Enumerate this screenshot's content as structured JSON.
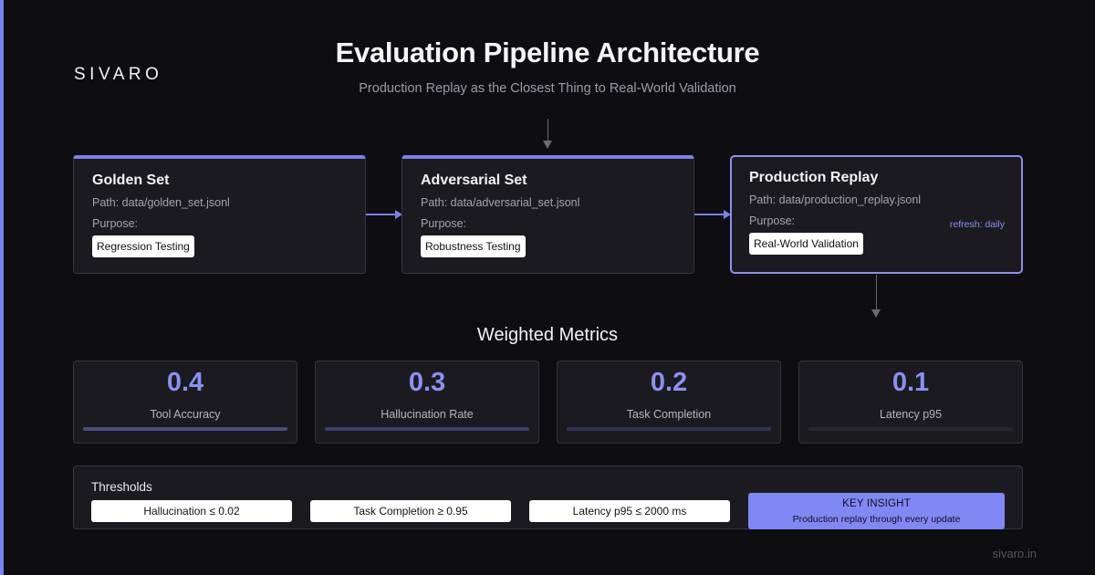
{
  "brand": {
    "logo": "SIVARO",
    "footer_url": "sivaro.in",
    "accent_color": "#7b80f0"
  },
  "header": {
    "title": "Evaluation Pipeline Architecture",
    "subtitle": "Production Replay as the Closest Thing to Real-World Validation"
  },
  "pipeline": {
    "stages": [
      {
        "name": "Golden Set",
        "path": "Path: data/golden_set.jsonl",
        "purpose_label": "Purpose:",
        "purpose": "Regression Testing",
        "note": "",
        "active": false
      },
      {
        "name": "Adversarial Set",
        "path": "Path: data/adversarial_set.jsonl",
        "purpose_label": "Purpose:",
        "purpose": "Robustness Testing",
        "note": "",
        "active": false
      },
      {
        "name": "Production Replay",
        "path": "Path: data/production_replay.jsonl",
        "purpose_label": "Purpose:",
        "purpose": "Real-World Validation",
        "note": "refresh: daily",
        "active": true
      }
    ]
  },
  "metrics": {
    "title": "Weighted Metrics",
    "items": [
      {
        "value": "0.4",
        "label": "Tool Accuracy",
        "weight": 0.4,
        "bar_color": "#4a4c84"
      },
      {
        "value": "0.3",
        "label": "Hallucination Rate",
        "weight": 0.3,
        "bar_color": "#3d3f6e"
      },
      {
        "value": "0.2",
        "label": "Task Completion",
        "weight": 0.2,
        "bar_color": "#323454"
      },
      {
        "value": "0.1",
        "label": "Latency p95",
        "weight": 0.1,
        "bar_color": "#26262e"
      }
    ]
  },
  "thresholds": {
    "title": "Thresholds",
    "items": [
      "Hallucination ≤ 0.02",
      "Task Completion ≥ 0.95",
      "Latency p95 ≤ 2000 ms"
    ],
    "insight": {
      "title": "KEY INSIGHT",
      "text": "Production replay through every update"
    }
  }
}
